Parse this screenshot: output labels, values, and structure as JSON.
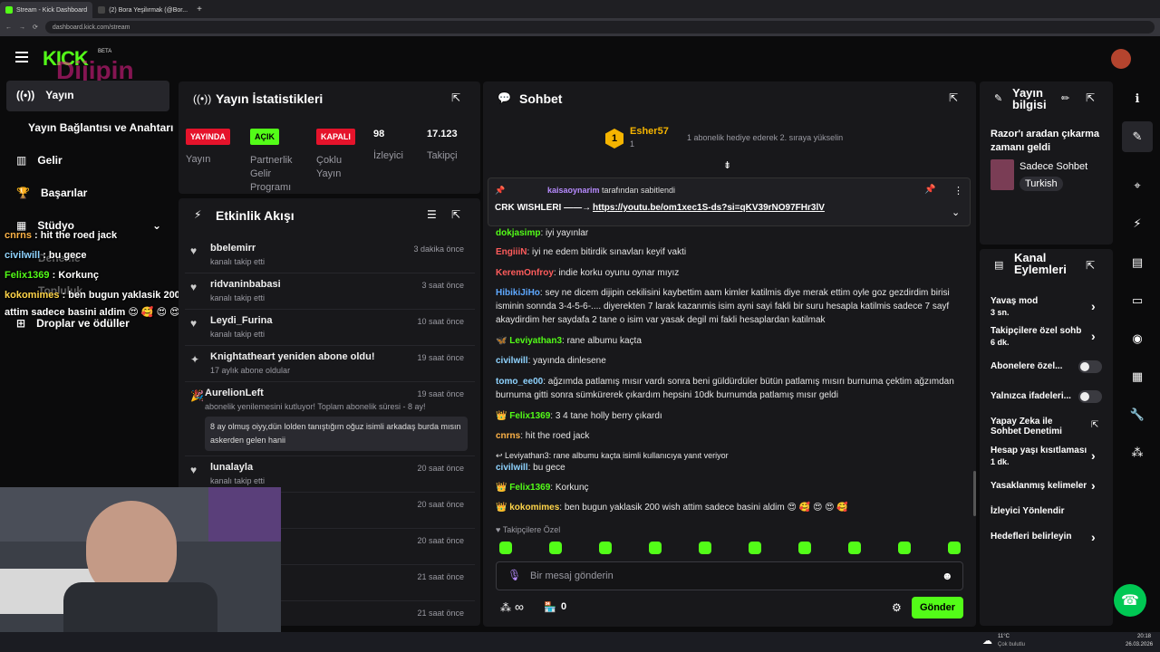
{
  "browser": {
    "tabs": [
      {
        "title": "Stream - Kick Dashboard",
        "color": "#53fc18"
      },
      {
        "title": "(2) Bora Yeşilırmak (@Bor...",
        "color": "#888"
      }
    ],
    "url": "dashboard.kick.com/stream",
    "new_tab": "+"
  },
  "header": {
    "logo_text": "KICK",
    "logo_sub": "BETA",
    "watermark": "Dijipin",
    "watermark_url": "www.dijipin.com"
  },
  "sidebar": {
    "items": [
      {
        "label": "Yayın",
        "icon": "broadcast-icon"
      },
      {
        "label": "Yayın Bağlantısı ve Anahtarı"
      },
      {
        "label": "Gelir",
        "icon": "chart-icon"
      },
      {
        "label": "Başarılar",
        "icon": "trophy-icon"
      },
      {
        "label": "Stüdyo",
        "icon": "studio-icon"
      },
      {
        "label": "Deneme"
      },
      {
        "label": "Topluluk"
      },
      {
        "label": "Droplar ve ödüller",
        "icon": "gift-icon"
      }
    ]
  },
  "overlay_chat": [
    {
      "user": "cnrns",
      "text": " : hit the roed jack"
    },
    {
      "user": "civilwill",
      "text": " : bu gece"
    },
    {
      "user": "Felix1369",
      "text": " : Korkunç"
    },
    {
      "user": "kokomimes",
      "text": " : ben bugun yaklasik 200 wish"
    },
    {
      "user": "",
      "text": "attim sadece basini aldim 😍 🥰 😍 😍 😍"
    }
  ],
  "stats": {
    "title": "Yayın İstatistikleri",
    "items": [
      {
        "badge": "YAYINDA",
        "label": "Yayın",
        "color": "#e5132b"
      },
      {
        "badge": "AÇIK",
        "label": "Partnerlik Gelir Programı",
        "color": "#53fc18"
      },
      {
        "badge": "KAPALI",
        "label": "Çoklu Yayın",
        "color": "#e5132b"
      },
      {
        "value": "98",
        "label": "İzleyici"
      },
      {
        "value": "17.123",
        "label": "Takipçi"
      }
    ]
  },
  "activity": {
    "title": "Etkinlik Akışı",
    "rows": [
      {
        "name": "bbelemirr",
        "sub": "kanalı takip etti",
        "time": "3 dakika önce",
        "icon": "heart-icon"
      },
      {
        "name": "ridvaninbabasi",
        "sub": "kanalı takip etti",
        "time": "3 saat önce",
        "icon": "heart-icon"
      },
      {
        "name": "Leydi_Furina",
        "sub": "kanalı takip etti",
        "time": "10 saat önce",
        "icon": "heart-icon"
      },
      {
        "name": "Knightatheart yeniden abone oldu!",
        "sub": "17 aylık abone oldular",
        "time": "19 saat önce",
        "icon": "sparkle-icon"
      },
      {
        "name": "AurelionLeft",
        "sub": "abonelik yenilemesini kutluyor! Toplam abonelik süresi - 8 ay!",
        "time": "19 saat önce",
        "icon": "confetti-icon",
        "note": "8 ay olmuş oiyy,dün lolden tanıştığım oğuz isimli arkadaş burda mısın askerden gelen hanii"
      },
      {
        "name": "lunalayla",
        "sub": "kanalı takip etti",
        "time": "20 saat önce",
        "icon": "heart-icon"
      },
      {
        "name": "",
        "sub": "",
        "time": "20 saat önce"
      },
      {
        "name": "",
        "sub": "",
        "time": "20 saat önce"
      },
      {
        "name": "",
        "sub": "",
        "time": "21 saat önce"
      },
      {
        "name": "",
        "sub": "",
        "time": "21 saat önce"
      }
    ]
  },
  "chat": {
    "title": "Sohbet",
    "top_gifter": {
      "rank": "1",
      "name": "Esher57",
      "count": "1",
      "note": "1 abonelik hediye ederek 2. sıraya yükselin"
    },
    "pinned": {
      "by": "kaisaoynarim",
      "by_suffix": " tarafından sabitlendi",
      "label": "CRK WISHLERI ——→ ",
      "link": "https://youtu.be/om1xec1S-ds?si=qKV39rNO97FHr3lV"
    },
    "messages": [
      {
        "user": "dokjasimp",
        "text": ": iyi yayınlar",
        "color": "#53fc18"
      },
      {
        "user": "EngiiiN",
        "text": ": iyi ne edem bitirdik sınavları keyif vakti",
        "color": "#ff5c5c"
      },
      {
        "user": "KeremOnfroy",
        "text": ": indie korku oyunu oynar mıyız",
        "color": "#ff5c5c"
      },
      {
        "user": "HibikiJiHo",
        "text": ": sey ne dicem dijipin cekilisini kaybettim aam kimler katilmis diye merak ettim oyle goz gezdirdim birisi isminin sonnda 3-4-5-6-.... diyerekten 7 larak kazanmis isim ayni sayi fakli bir suru hesapla katilmis sadece 7 sayf akaydirdim her saydafa 2 tane o isim var yasak degil mi fakli hesaplardan katilmak",
        "color": "#5ea8ff"
      },
      {
        "user": "Leviyathan3",
        "text": ": rane albumu kaçta",
        "color": "#53fc18"
      },
      {
        "user": "civilwill",
        "text": ": yayında dinlesene",
        "color": "#8fd3ff"
      },
      {
        "user": "tomo_ee00",
        "text": ": ağzımda patlamış mısır vardı sonra beni güldürdüler bütün patlamış mısırı burnuma çektim ağzımdan burnuma gitti sonra sümkürerek çıkardım hepsini 10dk burnumda patlamış mısır geldi",
        "color": "#8fd3ff"
      },
      {
        "user": "Felix1369",
        "text": ": 3 4 tane holly berry çıkardı",
        "color": "#53fc18"
      },
      {
        "user": "cnrns",
        "text": ": hit the roed jack",
        "color": "#ffb347"
      },
      {
        "reply": "Leviyathan3: rane albumu kaçta isimli kullanıcıya yanıt veriyor"
      },
      {
        "user": "civilwill",
        "text": ": bu gece",
        "color": "#8fd3ff"
      },
      {
        "user": "Felix1369",
        "text": ": Korkunç",
        "color": "#53fc18"
      },
      {
        "user": "kokomimes",
        "text": ": ben bugun yaklasik 200 wish attim sadece basini aldim 😍 🥰 😍 😍 🥰",
        "color": "#ffd54a"
      }
    ],
    "followers_only": "Takipçilere Özel",
    "placeholder": "Bir mesaj gönderin",
    "infinity": "∞",
    "store_count": "0",
    "send": "Gönder"
  },
  "stream_info": {
    "title": "Yayın bilgisi",
    "stream_title": "Razor'ı aradan çıkarma zamanı geldi",
    "category": "Sadece Sohbet",
    "tag": "Turkish"
  },
  "channel_actions": {
    "title": "Kanal Eylemleri",
    "items": [
      {
        "label": "Yavaş mod",
        "sub": "3 sn.",
        "type": "chevron"
      },
      {
        "label": "Takipçilere özel sohb",
        "sub": "6 dk.",
        "type": "chevron"
      },
      {
        "label": "Abonelere özel...",
        "type": "toggle"
      },
      {
        "label": "Yalnızca ifadeleri...",
        "type": "toggle"
      },
      {
        "label": "Yapay Zeka ile Sohbet Denetimi",
        "type": "external"
      },
      {
        "label": "Hesap yaşı kısıtlaması",
        "sub": "1 dk.",
        "type": "chevron"
      },
      {
        "label": "Yasaklanmış kelimeler",
        "type": "chevron"
      },
      {
        "label": "İzleyici Yönlendir",
        "type": "none"
      },
      {
        "label": "Hedefleri belirleyin",
        "type": "chevron"
      }
    ]
  },
  "taskbar": {
    "weather_temp": "11°C",
    "weather_text": "Çok bulutlu",
    "time": "20:18",
    "date": "26.03.2026"
  },
  "colors": {
    "brand": "#53fc18",
    "live": "#e5132b",
    "panel": "#18181b"
  }
}
